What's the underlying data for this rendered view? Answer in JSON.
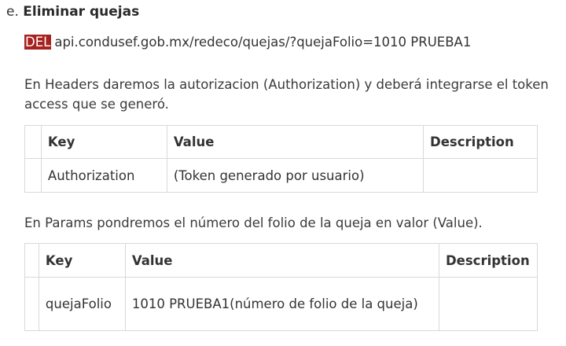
{
  "section": {
    "marker": "e.",
    "title": "Eliminar quejas"
  },
  "endpoint": {
    "method": "DEL",
    "url": "api.condusef.gob.mx/redeco/quejas/?quejaFolio=1010 PRUEBA1"
  },
  "headers_intro": "En Headers daremos la autorizacion (Authorization) y deberá integrarse el token access que se generó.",
  "headers_table": {
    "columns": [
      "Key",
      "Value",
      "Description"
    ],
    "rows": [
      [
        "Authorization",
        "(Token generado por usuario)",
        ""
      ]
    ]
  },
  "params_intro": "En Params pondremos el número del folio de la queja en valor (Value).",
  "params_table": {
    "columns": [
      "Key",
      "Value",
      "Description"
    ],
    "rows": [
      [
        "quejaFolio",
        "1010 PRUEBA1(número de folio de la queja)",
        ""
      ]
    ]
  },
  "colors": {
    "method_badge": "#a7211f",
    "border": "#d9d9d9"
  }
}
